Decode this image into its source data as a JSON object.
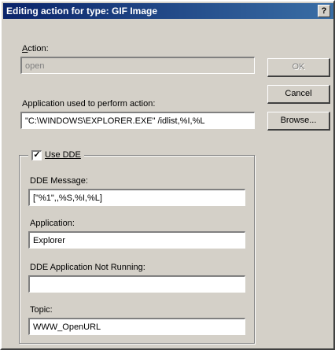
{
  "window": {
    "title": "Editing action for type: GIF Image",
    "help_label": "?"
  },
  "action": {
    "label_prefix": "A",
    "label_rest": "ction:",
    "value": "open"
  },
  "application_used": {
    "label_prefix": "Application used to perform action:",
    "value": "\"C:\\WINDOWS\\EXPLORER.EXE\" /idlist,%I,%L"
  },
  "buttons": {
    "ok": "OK",
    "cancel": "Cancel",
    "browse": "Browse..."
  },
  "use_dde": {
    "checked": true,
    "check_glyph": "✓",
    "label": "Use DDE"
  },
  "dde": {
    "message_label": "DDE Message:",
    "message_value": "[\"%1\",,%S,%I,%L]",
    "application_label": "Application:",
    "application_value": "Explorer",
    "not_running_label": "DDE Application Not Running:",
    "not_running_value": "",
    "topic_label": "Topic:",
    "topic_value": "WWW_OpenURL"
  }
}
